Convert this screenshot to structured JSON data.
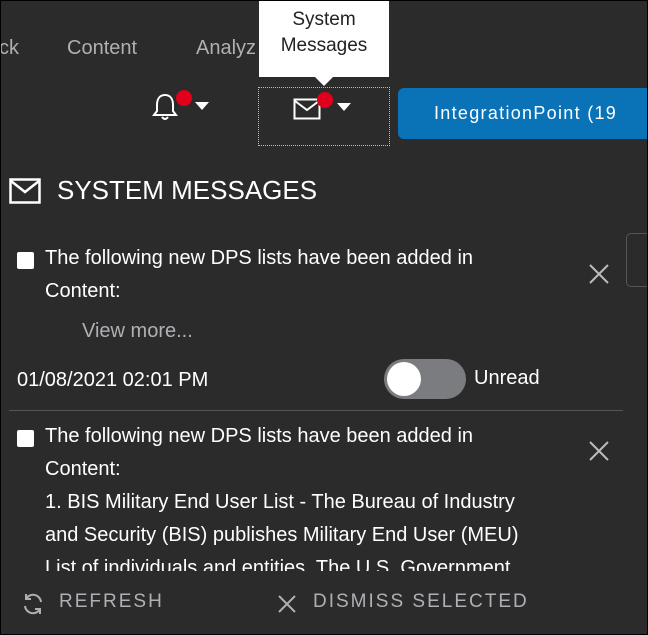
{
  "topnav": {
    "items": [
      "ck",
      "Content",
      "Analyz"
    ]
  },
  "tooltip": {
    "line1": "System",
    "line2": "Messages"
  },
  "integration_button": "IntegrationPoint (19",
  "panel": {
    "title": "SYSTEM MESSAGES"
  },
  "messages": [
    {
      "line1": "The following new DPS lists have been added in",
      "line2": "Content:",
      "view_more": "View more...",
      "timestamp": "01/08/2021 02:01 PM",
      "status": "Unread"
    },
    {
      "line1": "The following new DPS lists have been added in",
      "line2": "Content:",
      "line3": "1. BIS Military End User List - The Bureau of Industry",
      "line4": "and Security (BIS) publishes Military End User (MEU)",
      "line5": "List of individuals and entities. The U.S. Government"
    }
  ],
  "footer": {
    "refresh": "REFRESH",
    "dismiss": "DISMISS SELECTED"
  },
  "colors": {
    "background": "#2b2b2c",
    "accent": "#0a73b8",
    "notification_dot": "#e0001b"
  }
}
